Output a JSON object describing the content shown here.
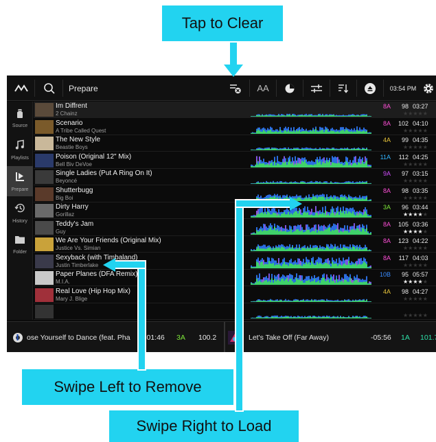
{
  "callouts": {
    "clear": "Tap to Clear",
    "remove": "Swipe Left to Remove",
    "load": "Swipe Right to Load"
  },
  "topbar": {
    "title": "Prepare",
    "time": "03:54 PM",
    "font_size_label": "AA"
  },
  "sidebar": [
    {
      "label": "Source",
      "icon": "usb-drive-icon"
    },
    {
      "label": "Playlists",
      "icon": "music-note-icon"
    },
    {
      "label": "Prepare",
      "icon": "prepare-list-icon",
      "active": true
    },
    {
      "label": "History",
      "icon": "history-clock-icon"
    },
    {
      "label": "Folder",
      "icon": "folder-icon"
    }
  ],
  "tracks": [
    {
      "title": "Im Diffrent",
      "artist": "2 Chainz",
      "key": "8A",
      "key_color": "#ff4fd8",
      "bpm": "98",
      "duration": "03:27",
      "rating": 0,
      "wave": "low",
      "selected": true
    },
    {
      "title": "Scenario",
      "artist": "A Tribe Called Quest",
      "key": "8A",
      "key_color": "#ff4fd8",
      "bpm": "102",
      "duration": "04:10",
      "rating": 0,
      "wave": "mid"
    },
    {
      "title": "The New Style",
      "artist": "Beastie Boys",
      "key": "4A",
      "key_color": "#e8c43a",
      "bpm": "99",
      "duration": "04:35",
      "rating": 0,
      "wave": "low"
    },
    {
      "title": "Poison (Original 12\" Mix)",
      "artist": "Bell Biv DeVoe",
      "key": "11A",
      "key_color": "#31b4ff",
      "bpm": "112",
      "duration": "04:25",
      "rating": 0,
      "wave": "high"
    },
    {
      "title": "Single Ladies (Put A Ring On It)",
      "artist": "Beyoncé",
      "key": "9A",
      "key_color": "#d24dff",
      "bpm": "97",
      "duration": "03:15",
      "rating": 0,
      "wave": "low"
    },
    {
      "title": "Shutterbugg",
      "artist": "Big Boi",
      "key": "8A",
      "key_color": "#ff4fd8",
      "bpm": "98",
      "duration": "03:35",
      "rating": 0,
      "wave": "mid"
    },
    {
      "title": "Dirty Harry",
      "artist": "Gorillaz",
      "key": "3A",
      "key_color": "#7ee83a",
      "bpm": "96",
      "duration": "03:44",
      "rating": 4,
      "wave": "high"
    },
    {
      "title": "Teddy's Jam",
      "artist": "Guy",
      "key": "8A",
      "key_color": "#ff4fd8",
      "bpm": "105",
      "duration": "03:36",
      "rating": 4,
      "wave": "high"
    },
    {
      "title": "We Are Your Friends (Original Mix)",
      "artist": "Justice Vs. Simian",
      "key": "8A",
      "key_color": "#ff4fd8",
      "bpm": "123",
      "duration": "04:22",
      "rating": 0,
      "wave": "mid"
    },
    {
      "title": "Sexyback (with Timbaland)",
      "artist": "Justin Timberlake",
      "key": "8A",
      "key_color": "#ff4fd8",
      "bpm": "117",
      "duration": "04:03",
      "rating": 0,
      "wave": "high"
    },
    {
      "title": "Paper Planes (DFA Remix)",
      "artist": "M.I.A.",
      "key": "10B",
      "key_color": "#3a8cff",
      "bpm": "95",
      "duration": "05:57",
      "rating": 4,
      "wave": "high"
    },
    {
      "title": "Real Love (Hip Hop Mix)",
      "artist": "Mary J. Blige",
      "key": "4A",
      "key_color": "#e8c43a",
      "bpm": "98",
      "duration": "04:27",
      "rating": 0,
      "wave": "low"
    },
    {
      "title": "",
      "artist": "",
      "key": "",
      "key_color": "#888",
      "bpm": "",
      "duration": "",
      "rating": 0,
      "wave": "low"
    }
  ],
  "decks": {
    "left": {
      "title": "ose Yourself to Dance (feat. Pha",
      "time": "-01:46",
      "key": "3A",
      "key_color": "#7ee83a",
      "bpm": "100.2"
    },
    "right": {
      "title": "Let's Take Off (Far Away)",
      "time": "-05:56",
      "key": "1A",
      "key_color": "#2ee0a8",
      "bpm": "101.7"
    }
  },
  "colors": {
    "accent": "#22d3f0",
    "wave_blue": "#2b6de0",
    "wave_green": "#3fd26b",
    "wave_purple": "#a24de0"
  }
}
